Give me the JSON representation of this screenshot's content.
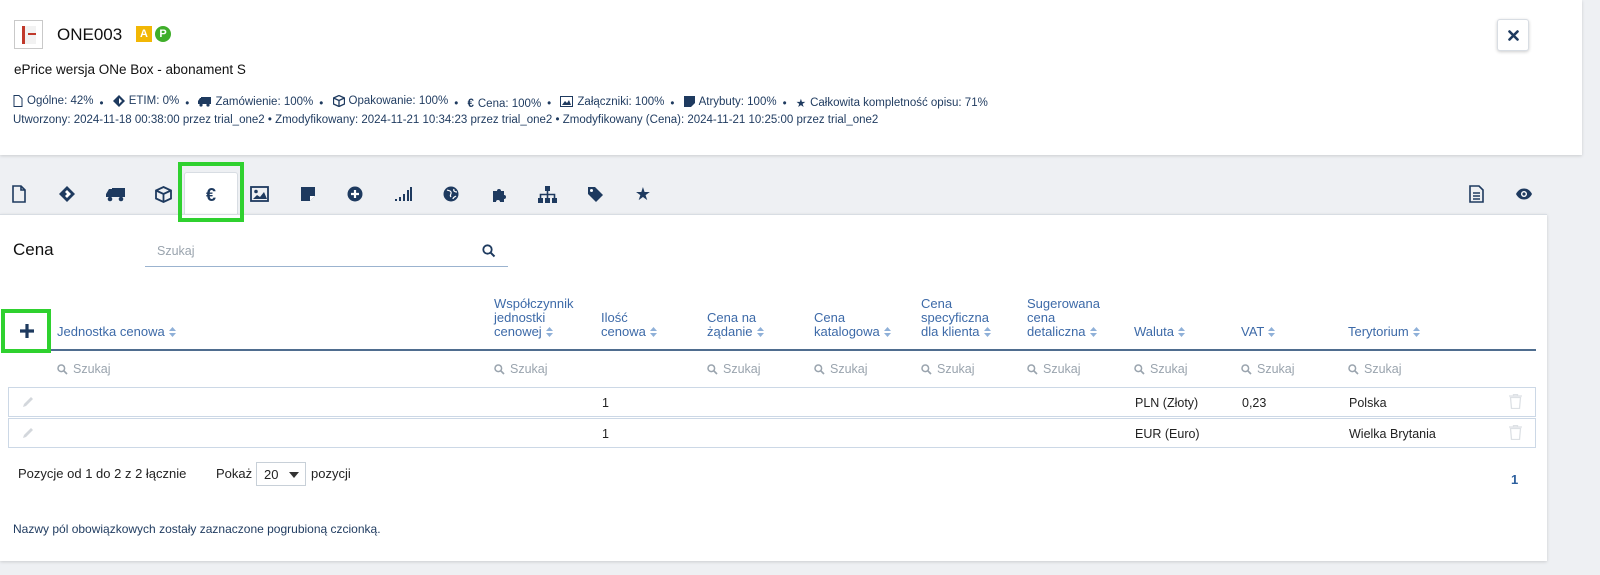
{
  "product": {
    "code": "ONE003",
    "badges": [
      "A",
      "P"
    ],
    "name": "ePrice wersja ONe Box - abonament S",
    "stats": [
      {
        "icon": "file-icon",
        "label": "Ogólne: 42%"
      },
      {
        "icon": "etim-icon",
        "label": "ETIM: 0%"
      },
      {
        "icon": "truck-icon",
        "label": "Zamówienie: 100%"
      },
      {
        "icon": "box-icon",
        "label": "Opakowanie: 100%"
      },
      {
        "icon": "euro-icon",
        "label": "Cena: 100%"
      },
      {
        "icon": "image-icon",
        "label": "Załączniki: 100%"
      },
      {
        "icon": "note-icon",
        "label": "Atrybuty: 100%"
      },
      {
        "icon": "star-icon",
        "label": "Całkowita kompletność opisu: 71%"
      }
    ],
    "dates": "Utworzony: 2024-11-18 00:38:00 przez trial_one2 • Zmodyfikowany: 2024-11-21 10:34:23 przez trial_one2 • Zmodyfikowany (Cena): 2024-11-21 10:25:00 przez trial_one2"
  },
  "tabs": [
    "file-icon",
    "etim-icon",
    "truck-icon",
    "box-icon",
    "euro-icon",
    "image-icon",
    "note-icon",
    "plus-circle-icon",
    "signal-icon",
    "globe-icon",
    "puzzle-icon",
    "sitemap-icon",
    "tag-icon",
    "star-icon"
  ],
  "active_tab": "euro-icon",
  "section": {
    "title": "Cena",
    "search_placeholder": "Szukaj"
  },
  "table": {
    "columns": [
      "Jednostka cenowa",
      "Współczynnik jednostki cenowej",
      "Ilość cenowa",
      "Cena na żądanie",
      "Cena katalogowa",
      "Cena specyficzna dla klienta",
      "Sugerowana cena detaliczna",
      "Waluta",
      "VAT",
      "Terytorium"
    ],
    "filter_placeholder": "Szukaj",
    "rows": [
      {
        "qty": "1",
        "currency": "PLN (Złoty)",
        "vat": "0,23",
        "territory": "Polska"
      },
      {
        "qty": "1",
        "currency": "EUR (Euro)",
        "vat": "",
        "territory": "Wielka Brytania"
      }
    ]
  },
  "pagination": {
    "info": "Pozycje od 1 do 2 z 2 łącznie",
    "show_label": "Pokaż",
    "page_size": "20",
    "show_after": "pozycji",
    "current_page": "1"
  },
  "footer_note": "Nazwy pól obowiązkowych zostały zaznaczone pogrubioną czcionką.",
  "colors": {
    "accent": "#2c5f9e",
    "highlight": "#2fd12f",
    "badge_a": "#f2b705",
    "badge_p": "#3fae2a"
  }
}
